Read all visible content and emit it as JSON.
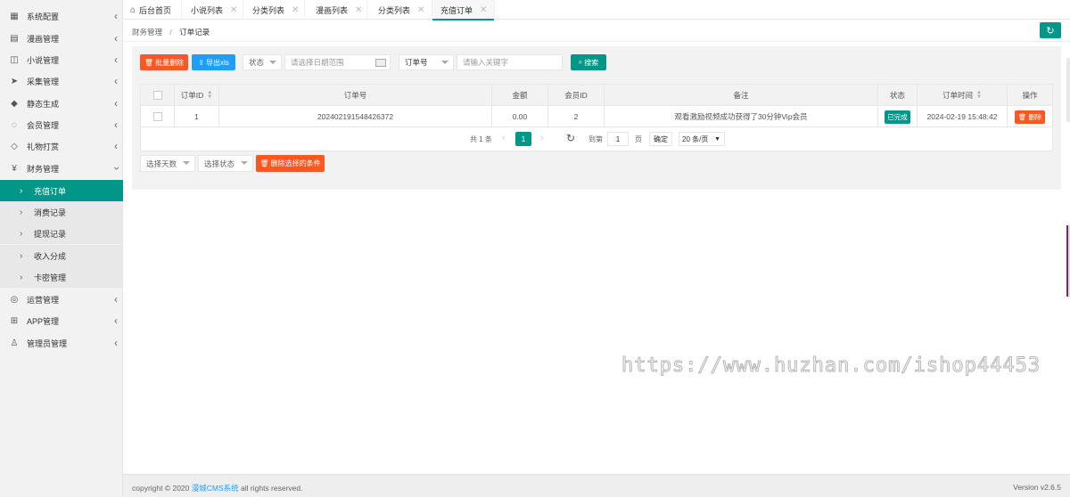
{
  "sidebar": {
    "items": [
      {
        "label": "系统配置",
        "icon": "settings-grid-icon"
      },
      {
        "label": "漫画管理",
        "icon": "book-icon"
      },
      {
        "label": "小说管理",
        "icon": "open-book-icon"
      },
      {
        "label": "采集管理",
        "icon": "paper-plane-icon"
      },
      {
        "label": "静态生成",
        "icon": "layers-icon"
      },
      {
        "label": "会员管理",
        "icon": "chat-icon"
      },
      {
        "label": "礼物打赏",
        "icon": "diamond-icon"
      },
      {
        "label": "财务管理",
        "icon": "yen-icon"
      }
    ],
    "finance_sub": [
      {
        "label": "充值订单"
      },
      {
        "label": "消费记录"
      },
      {
        "label": "提现记录"
      },
      {
        "label": "收入分成"
      },
      {
        "label": "卡密管理"
      }
    ],
    "items_after": [
      {
        "label": "运营管理",
        "icon": "globe-icon"
      },
      {
        "label": "APP管理",
        "icon": "windows-icon"
      },
      {
        "label": "管理员管理",
        "icon": "user-icon"
      }
    ]
  },
  "tabs": [
    {
      "label": "后台首页"
    },
    {
      "label": "小说列表"
    },
    {
      "label": "分类列表"
    },
    {
      "label": "漫画列表"
    },
    {
      "label": "分类列表"
    },
    {
      "label": "充值订单"
    }
  ],
  "breadcrumb": {
    "parent": "财务管理",
    "sep": "/",
    "current": "订单记录"
  },
  "toolbar": {
    "batch_delete": "批量删除",
    "export": "导出xls",
    "status_select": "状态",
    "date_placeholder": "请选择日期范围",
    "field_select": "订单号",
    "keyword_placeholder": "请输入关键字",
    "search": "搜索"
  },
  "table": {
    "headers": [
      "订单ID",
      "订单号",
      "金额",
      "会员ID",
      "备注",
      "状态",
      "订单时间",
      "操作"
    ],
    "rows": [
      {
        "id": "1",
        "order_no": "202402191548426372",
        "amount": "0.00",
        "member_id": "2",
        "remark": "观看激励视频成功获得了30分钟Vip会员",
        "status": "已完成",
        "time": "2024-02-19 15:48:42",
        "action": "删除"
      }
    ]
  },
  "pager": {
    "total": "共 1 条",
    "current": "1",
    "goto": "到第",
    "page_input": "1",
    "page_unit": "页",
    "confirm": "确定",
    "per_page": "20 条/页"
  },
  "bottom_filters": {
    "days": "选择天数",
    "status": "选择状态",
    "delete_selected": "删除选择的条件"
  },
  "footer": {
    "copyright_pre": "copyright © 2020",
    "brand": "漫城CMS系统",
    "copyright_post": "all rights reserved.",
    "version": "Version v2.6.5"
  },
  "watermark": "https://www.huzhan.com/ishop44453",
  "colors": {
    "accent": "#009688",
    "danger": "#ff5722",
    "info": "#1e9fff"
  }
}
